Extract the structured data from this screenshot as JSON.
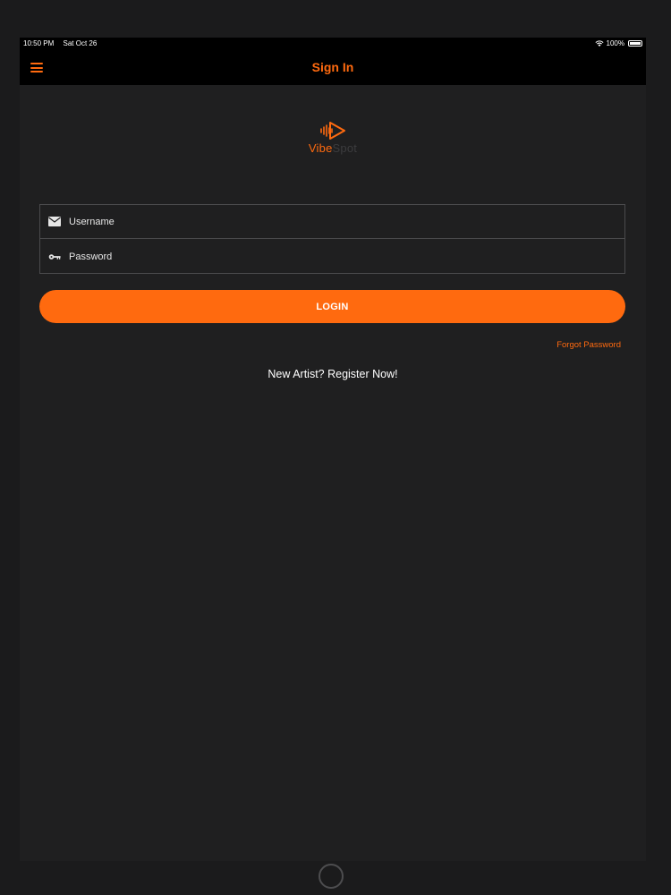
{
  "status_bar": {
    "time": "10:50 PM",
    "date": "Sat Oct 26",
    "battery": "100%",
    "icons": [
      "wifi-icon",
      "battery-icon"
    ]
  },
  "nav": {
    "title": "Sign In",
    "menu_icon": "menu-icon"
  },
  "logo": {
    "text_primary": "Vibe",
    "text_secondary": "Spot"
  },
  "form": {
    "username": {
      "placeholder": "Username",
      "value": "",
      "icon": "mail-icon"
    },
    "password": {
      "placeholder": "Password",
      "value": "",
      "icon": "key-icon"
    },
    "login_label": "LOGIN",
    "forgot_label": "Forgot Password",
    "register_label": "New Artist? Register Now!"
  },
  "colors": {
    "accent": "#ff6a0f",
    "background": "#1f1f20",
    "navbar": "#000000",
    "field_border": "#4a4a4c"
  }
}
